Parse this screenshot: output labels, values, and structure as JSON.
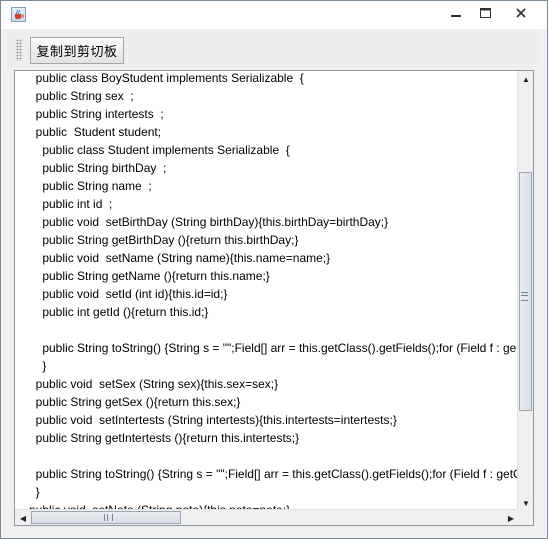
{
  "window": {
    "icon": "java-cup-icon",
    "controls": {
      "minimize_icon": "minimize-icon",
      "maximize_icon": "maximize-icon",
      "close_icon": "close-icon"
    }
  },
  "toolbar": {
    "copy_label": "复制到剪切板"
  },
  "code_lines": [
    "  public class BoyStudent implements Serializable  {",
    "  public String sex  ;",
    "  public String intertests  ;",
    "  public  Student student;",
    "    public class Student implements Serializable  {",
    "    public String birthDay  ;",
    "    public String name  ;",
    "    public int id  ;",
    "    public void  setBirthDay (String birthDay){this.birthDay=birthDay;}",
    "    public String getBirthDay (){return this.birthDay;}",
    "    public void  setName (String name){this.name=name;}",
    "    public String getName (){return this.name;}",
    "    public void  setId (int id){this.id=id;}",
    "    public int getId (){return this.id;}",
    "",
    "    public String toString() {String s = \"\";Field[] arr = this.getClass().getFields();for (Field f : ge",
    "    }",
    "  public void  setSex (String sex){this.sex=sex;}",
    "  public String getSex (){return this.sex;}",
    "  public void  setIntertests (String intertests){this.intertests=intertests;}",
    "  public String getIntertests (){return this.intertests;}",
    "",
    "  public String toString() {String s = \"\";Field[] arr = this.getClass().getFields();for (Field f : getC",
    "  }",
    "public void  setNote (String note){this.note=note;}"
  ]
}
